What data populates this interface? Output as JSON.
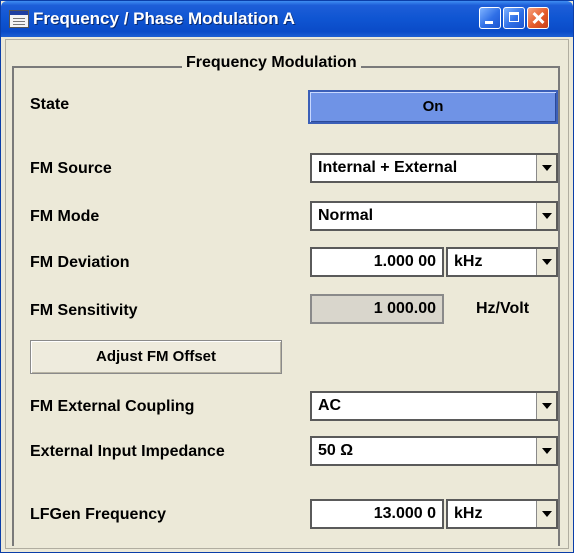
{
  "window": {
    "title": "Frequency / Phase Modulation A"
  },
  "group": {
    "title": "Frequency Modulation"
  },
  "state": {
    "label": "State",
    "value": "On"
  },
  "fm_source": {
    "label": "FM Source",
    "value": "Internal + External"
  },
  "fm_mode": {
    "label": "FM Mode",
    "value": "Normal"
  },
  "fm_deviation": {
    "label": "FM Deviation",
    "value": "1.000 00",
    "unit": "kHz"
  },
  "fm_sensitivity": {
    "label": "FM Sensitivity",
    "value": "1 000.00",
    "unit": "Hz/Volt"
  },
  "adjust": {
    "label": "Adjust FM Offset"
  },
  "ext_coupling": {
    "label": "FM External Coupling",
    "value": "AC"
  },
  "ext_impedance": {
    "label": "External Input Impedance",
    "value": "50 Ω"
  },
  "lfgen": {
    "label": "LFGen Frequency",
    "value": "13.000 0",
    "unit": "kHz"
  },
  "colors": {
    "title_bar": "#0f55d2",
    "state_on": "#6f93e6",
    "background": "#ece9d8"
  }
}
